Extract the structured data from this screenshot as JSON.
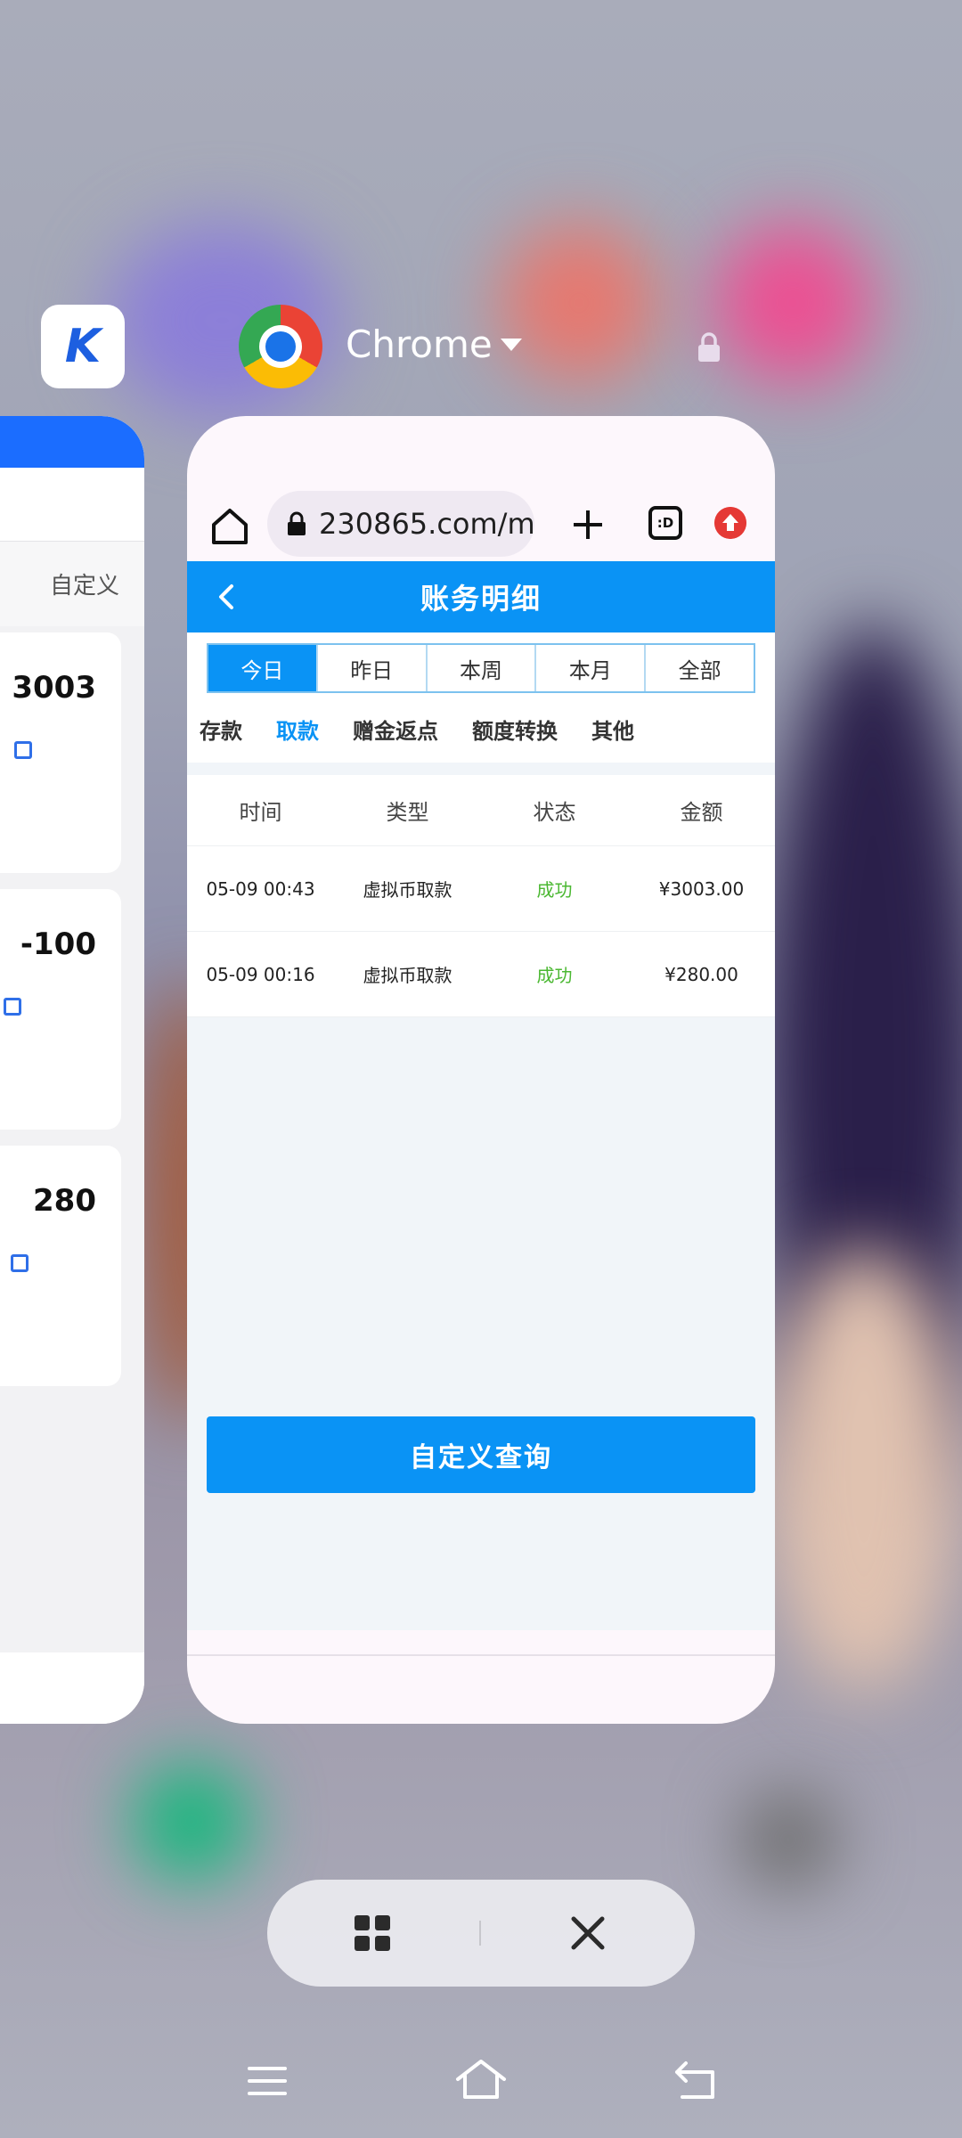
{
  "recents": {
    "app_name": "Chrome",
    "left_app_icon_text": "K"
  },
  "left_card": {
    "filter_label": "自定义",
    "amounts": [
      "3003",
      "-100",
      "280"
    ]
  },
  "browser": {
    "url": "230865.com/m/",
    "tabs_badge": ":D"
  },
  "page": {
    "title": "账务明细",
    "period_tabs": [
      {
        "label": "今日",
        "active": true
      },
      {
        "label": "昨日"
      },
      {
        "label": "本周"
      },
      {
        "label": "本月"
      },
      {
        "label": "全部"
      }
    ],
    "type_tabs": [
      {
        "label": "存款"
      },
      {
        "label": "取款",
        "active": true
      },
      {
        "label": "赠金返点"
      },
      {
        "label": "额度转换"
      },
      {
        "label": "其他"
      }
    ],
    "table": {
      "headers": [
        "时间",
        "类型",
        "状态",
        "金额"
      ],
      "rows": [
        {
          "time": "05-09 00:43",
          "type": "虚拟币取款",
          "status": "成功",
          "amount": "¥3003.00"
        },
        {
          "time": "05-09 00:16",
          "type": "虚拟币取款",
          "status": "成功",
          "amount": "¥280.00"
        }
      ]
    },
    "custom_query_label": "自定义查询"
  },
  "colors": {
    "accent": "#0a93f5",
    "success": "#4bb832"
  }
}
